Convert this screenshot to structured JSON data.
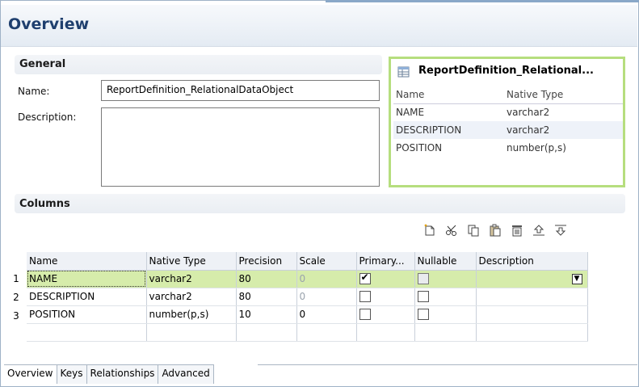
{
  "page": {
    "title": "Overview"
  },
  "general": {
    "section_title": "General",
    "name_label": "Name:",
    "name_value": "ReportDefinition_RelationalDataObject",
    "description_label": "Description:",
    "description_value": ""
  },
  "preview": {
    "title": "ReportDefinition_Relational...",
    "columns": [
      "Name",
      "Native Type"
    ],
    "rows": [
      {
        "name": "NAME",
        "type": "varchar2"
      },
      {
        "name": "DESCRIPTION",
        "type": "varchar2"
      },
      {
        "name": "POSITION",
        "type": "number(p,s)"
      }
    ]
  },
  "columns_section": {
    "section_title": "Columns",
    "toolbar": [
      "new-column-icon",
      "cut-icon",
      "copy-icon",
      "paste-icon",
      "delete-icon",
      "move-up-icon",
      "move-down-icon"
    ],
    "headers": [
      "Name",
      "Native Type",
      "Precision",
      "Scale",
      "Primary...",
      "Nullable",
      "Description"
    ],
    "rows": [
      {
        "num": "1",
        "name": "NAME",
        "type": "varchar2",
        "precision": "80",
        "scale": "0",
        "primary": true,
        "nullable": false,
        "description": ""
      },
      {
        "num": "2",
        "name": "DESCRIPTION",
        "type": "varchar2",
        "precision": "80",
        "scale": "0",
        "primary": false,
        "nullable": false,
        "description": ""
      },
      {
        "num": "3",
        "name": "POSITION",
        "type": "number(p,s)",
        "precision": "10",
        "scale": "0",
        "primary": false,
        "nullable": false,
        "description": ""
      }
    ]
  },
  "tabs": [
    "Overview",
    "Keys",
    "Relationships",
    "Advanced"
  ],
  "colors": {
    "title": "#1f3f6e",
    "selected_row": "#d6ecab",
    "preview_border": "#b6de7e"
  }
}
